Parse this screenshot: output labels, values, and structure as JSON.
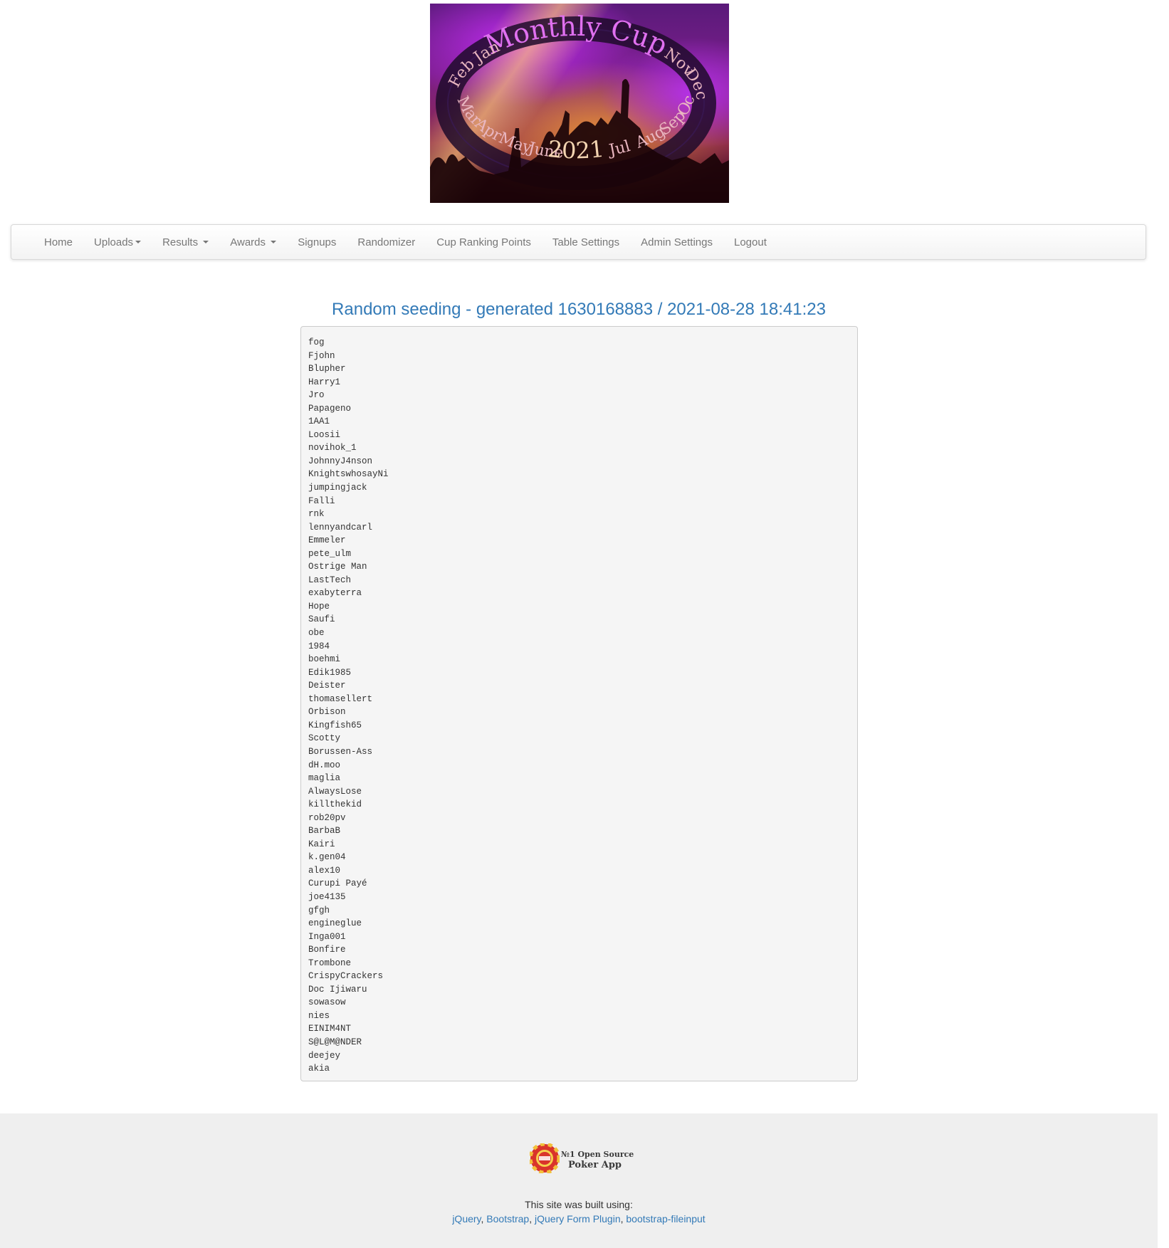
{
  "banner": {
    "title": "Monthly Cup",
    "year": "2021",
    "months": [
      "Jan",
      "Feb",
      "Mar",
      "Apr",
      "May",
      "June",
      "Jul",
      "Aug",
      "Sep",
      "Oct",
      "Nov",
      "Dec"
    ]
  },
  "nav": {
    "items": [
      {
        "label": "Home",
        "dropdown": false
      },
      {
        "label": "Uploads",
        "dropdown": true
      },
      {
        "label": "Results",
        "dropdown": true
      },
      {
        "label": "Awards",
        "dropdown": true
      },
      {
        "label": "Signups",
        "dropdown": false
      },
      {
        "label": "Randomizer",
        "dropdown": false
      },
      {
        "label": "Cup Ranking Points",
        "dropdown": false
      },
      {
        "label": "Table Settings",
        "dropdown": false
      },
      {
        "label": "Admin Settings",
        "dropdown": false
      },
      {
        "label": "Logout",
        "dropdown": false
      }
    ]
  },
  "seeding": {
    "title": "Random seeding - generated 1630168883 / 2021-08-28 18:41:23",
    "players": [
      "fog",
      "Fjohn",
      "Blupher",
      "Harry1",
      "Jro",
      "Papageno",
      "1AA1",
      "Loosii",
      "novihok_1",
      "JohnnyJ4nson",
      "KnightswhosayNi",
      "jumpingjack",
      "Falli",
      "rnk",
      "lennyandcarl",
      "Emmeler",
      "pete_ulm",
      "Ostrige Man",
      "LastTech",
      "exabyterra",
      "Hope",
      "Saufi",
      "obe",
      "1984",
      "boehmi",
      "Edik1985",
      "Deister",
      "thomasellert",
      "Orbison",
      "Kingfish65",
      "Scotty",
      "Borussen-Ass",
      "dH.moo",
      "maglia",
      "AlwaysLose",
      "killthekid",
      "rob20pv",
      "BarbaB",
      "Kairi",
      "k.gen04",
      "alex10",
      "Curupi Payé",
      "joe4135",
      "gfgh",
      "engineglue",
      "Inga001",
      "Bonfire",
      "Trombone",
      "CrispyCrackers",
      "Doc Ijiwaru",
      "sowasow",
      "nies",
      "EINIM4NT",
      "S@L@M@NDER",
      "deejey",
      "akia"
    ]
  },
  "footer": {
    "badge_line1": "№1 Open Source",
    "badge_line2": "Poker App",
    "built_text": "This site was built using:",
    "links": [
      "jQuery",
      "Bootstrap",
      "jQuery Form Plugin",
      "bootstrap-fileinput"
    ],
    "separator": ", "
  }
}
